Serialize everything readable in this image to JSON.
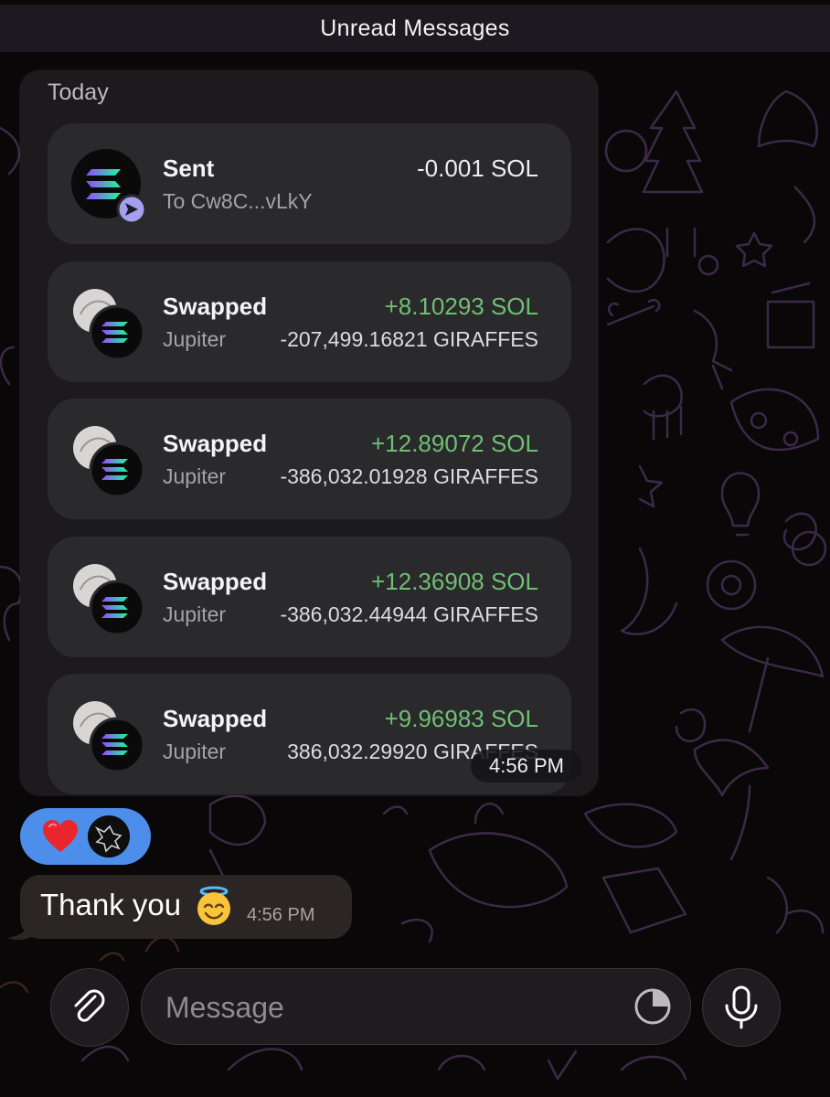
{
  "header": {
    "unread_label": "Unread Messages"
  },
  "wallet_card": {
    "date_label": "Today",
    "transactions": [
      {
        "title": "Sent",
        "subtitle": "To Cw8C...vLkY",
        "amount": "-0.001 SOL",
        "detail": "",
        "icon": "solana-send-icon"
      },
      {
        "title": "Swapped",
        "subtitle": "Jupiter",
        "amount": "+8.10293 SOL",
        "detail": "-207,499.16821 GIRAFFES",
        "icon": "swap-token-icon"
      },
      {
        "title": "Swapped",
        "subtitle": "Jupiter",
        "amount": "+12.89072 SOL",
        "detail": "-386,032.01928 GIRAFFES",
        "icon": "swap-token-icon"
      },
      {
        "title": "Swapped",
        "subtitle": "Jupiter",
        "amount": "+12.36908 SOL",
        "detail": "-386,032.44944 GIRAFFES",
        "icon": "swap-token-icon"
      },
      {
        "title": "Swapped",
        "subtitle": "Jupiter",
        "amount": "+9.96983 SOL",
        "detail": "386,032.29920 GIRAFFES",
        "icon": "swap-token-icon"
      }
    ],
    "time": "4:56 PM"
  },
  "reaction": {
    "emoji": "heart-icon",
    "color": "#4c8ee9"
  },
  "reply_message": {
    "text": "Thank you",
    "emoji": "angel-face-icon",
    "time": "4:56 PM"
  },
  "composer": {
    "placeholder": "Message"
  },
  "colors": {
    "positive": "#6fbf73",
    "background": "#0a0709",
    "card": "#1c1a1c",
    "row": "#2a292c"
  }
}
